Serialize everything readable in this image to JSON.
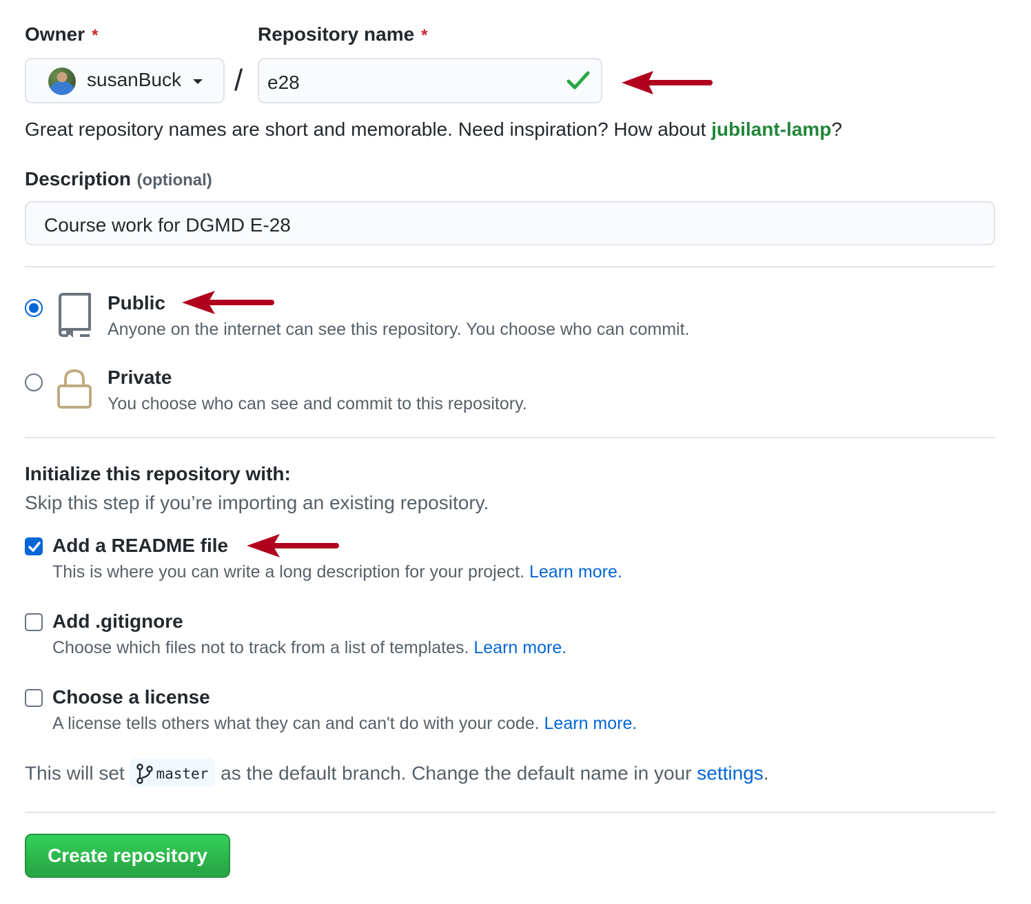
{
  "owner": {
    "label": "Owner",
    "required_mark": "*",
    "selected": "susanBuck"
  },
  "separator": "/",
  "repo_name": {
    "label": "Repository name",
    "required_mark": "*",
    "value": "e28"
  },
  "name_hint": {
    "text": "Great repository names are short and memorable. Need inspiration? How about ",
    "suggestion": "jubilant-lamp",
    "suffix": "?"
  },
  "description": {
    "label": "Description",
    "optional": "(optional)",
    "value": "Course work for DGMD E-28"
  },
  "visibility": {
    "public": {
      "title": "Public",
      "desc": "Anyone on the internet can see this repository. You choose who can commit.",
      "checked": true
    },
    "private": {
      "title": "Private",
      "desc": "You choose who can see and commit to this repository.",
      "checked": false
    }
  },
  "init": {
    "heading": "Initialize this repository with:",
    "subheading": "Skip this step if you’re importing an existing repository.",
    "readme": {
      "title": "Add a README file",
      "desc": "This is where you can write a long description for your project.",
      "link": "Learn more.",
      "checked": true
    },
    "gitignore": {
      "title": "Add .gitignore",
      "desc": "Choose which files not to track from a list of templates.",
      "link": "Learn more.",
      "checked": false
    },
    "license": {
      "title": "Choose a license",
      "desc": "A license tells others what they can and can't do with your code.",
      "link": "Learn more.",
      "checked": false
    }
  },
  "branch_note": {
    "prefix": "This will set",
    "branch": "master",
    "middle": "as the default branch. Change the default name in your",
    "link": "settings",
    "suffix": "."
  },
  "submit_label": "Create repository",
  "colors": {
    "annotation_arrow": "#b0001e",
    "accent_blue": "#0366d6",
    "success_green": "#28a745",
    "suggestion_green": "#22863a"
  }
}
